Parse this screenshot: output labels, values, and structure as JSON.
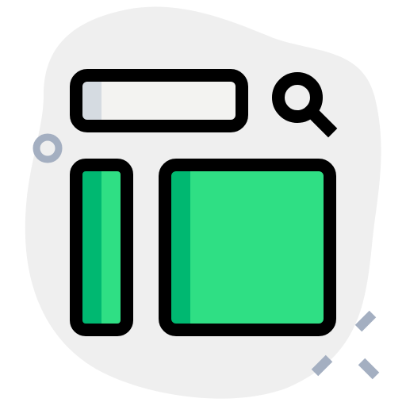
{
  "icon": {
    "name": "search-layout-icon",
    "parts": [
      "background-blob",
      "search-bar",
      "search-icon",
      "sidebar-panel",
      "content-panel",
      "ring-decoration",
      "sparkle-decoration"
    ]
  },
  "colors": {
    "blob": "#efefef",
    "stroke": "#000000",
    "search_bar_fill": "#f3f3f1",
    "search_bar_shade": "#d5dbe1",
    "panel_fill": "#2fdf84",
    "panel_shade": "#00b871",
    "decoration": "#a4afc1"
  }
}
